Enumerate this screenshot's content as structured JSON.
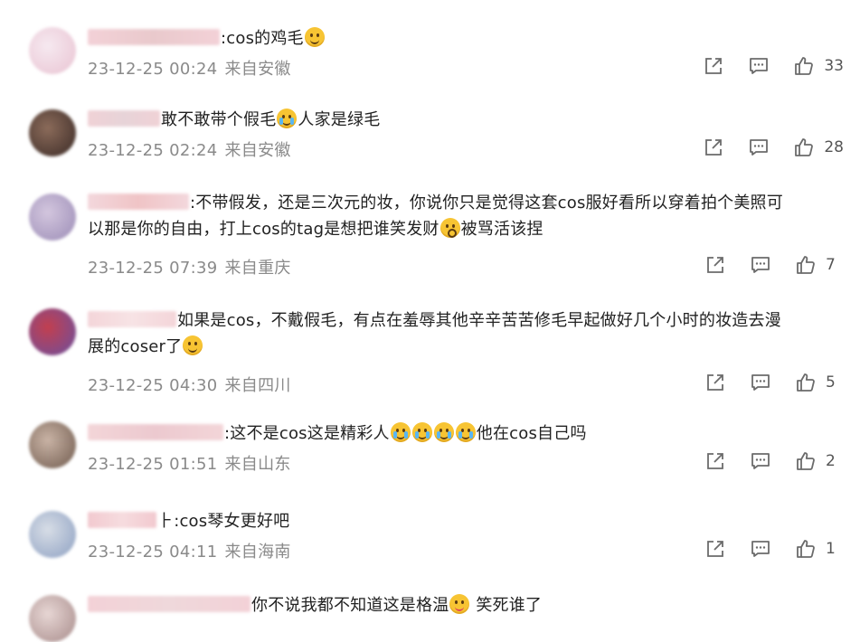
{
  "comments": [
    {
      "avatar_colors": [
        "#e9c3d2",
        "#f6e9f0"
      ],
      "name_colors": [
        "#f3d1d7",
        "#e9c9cc"
      ],
      "name_width": 146,
      "text": ":cos的鸡毛",
      "text_after": "",
      "emojis_after": [
        "smile"
      ],
      "time": "23-12-25 00:24",
      "location": "来自安徽",
      "likes": "33"
    },
    {
      "avatar_colors": [
        "#3a2a26",
        "#8b6b5a"
      ],
      "name_colors": [
        "#f0d2d6",
        "#e7d3d8"
      ],
      "name_width": 80,
      "text": "敢不敢带个假毛",
      "emojis_mid": [
        "cry-laugh"
      ],
      "text_after": "人家是绿毛",
      "time": "23-12-25 02:24",
      "location": "来自安徽",
      "likes": "28"
    },
    {
      "avatar_colors": [
        "#9b8cb6",
        "#d3c6de"
      ],
      "name_colors": [
        "#f3d7dc",
        "#f0c4c6"
      ],
      "name_width": 112,
      "text_line1": ":不带假发，还是三次元的妆，你说你只是觉得这套cos服好看所以穿着拍个美照可",
      "text_line2a": "以那是你的自由，打上cos的tag是想把谁笑发财",
      "emojis_line2": [
        "scream"
      ],
      "text_line2b": "被骂活该捏",
      "time": "23-12-25 07:39",
      "location": "来自重庆",
      "likes": "7"
    },
    {
      "avatar_colors": [
        "#6a4fa0",
        "#c23f4f"
      ],
      "name_colors": [
        "#f4d5d9",
        "#f7e3e5"
      ],
      "name_width": 98,
      "text_line1": "如果是cos，不戴假毛，有点在羞辱其他辛辛苦苦修毛早起做好几个小时的妆造去漫",
      "text_line2a": "展的coser了",
      "emojis_line2": [
        "think"
      ],
      "text_line2b": "",
      "time": "23-12-25 04:30",
      "location": "来自四川",
      "likes": "5"
    },
    {
      "avatar_colors": [
        "#6f5a4d",
        "#c9b3a5"
      ],
      "name_colors": [
        "#f3d5d8",
        "#ecc9cf"
      ],
      "name_width": 150,
      "text": ":这不是cos这是精彩人",
      "emojis_mid": [
        "cry",
        "cry",
        "cry",
        "cry"
      ],
      "text_after": "他在cos自己吗",
      "time": "23-12-25 01:51",
      "location": "来自山东",
      "likes": "2"
    },
    {
      "avatar_colors": [
        "#8da0c2",
        "#d7dde6"
      ],
      "name_colors": [
        "#f2c9cf",
        "#f6dcdf"
      ],
      "name_width": 76,
      "text": "⺊:cos琴女更好吧",
      "text_after": "",
      "emojis_after": [],
      "time": "23-12-25 04:11",
      "location": "来自海南",
      "likes": "1"
    },
    {
      "avatar_colors": [
        "#a78b8a",
        "#e7d6d4"
      ],
      "name_colors": [
        "#f3d1d7",
        "#efd8db"
      ],
      "name_width": 180,
      "text": "你不说我都不知道这是格温",
      "emojis_mid": [
        "tongue"
      ],
      "text_after": " 笑死谁了",
      "time": "",
      "location": "",
      "likes": ""
    }
  ]
}
